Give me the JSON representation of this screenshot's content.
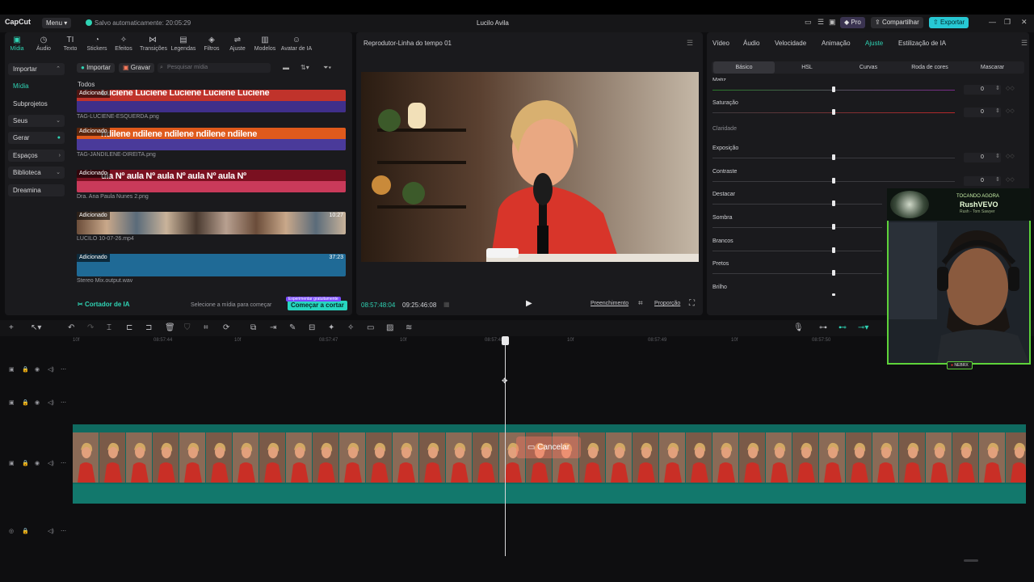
{
  "app": {
    "logo": "CapCut",
    "menu": "Menu",
    "autosave": "Salvo automaticamente: 20:05:29",
    "title": "Lucilo Avila",
    "pro": "Pro",
    "share": "Compartilhar",
    "export": "Exportar"
  },
  "toolbar": {
    "tools": [
      {
        "label": "Mídia",
        "icon": "media-icon"
      },
      {
        "label": "Áudio",
        "icon": "audio-icon"
      },
      {
        "label": "Texto",
        "icon": "text-icon"
      },
      {
        "label": "Stickers",
        "icon": "sticker-icon"
      },
      {
        "label": "Efeitos",
        "icon": "effects-icon"
      },
      {
        "label": "Transições",
        "icon": "transition-icon"
      },
      {
        "label": "Legendas",
        "icon": "captions-icon"
      },
      {
        "label": "Filtros",
        "icon": "filter-icon"
      },
      {
        "label": "Ajuste",
        "icon": "adjust-icon"
      },
      {
        "label": "Modelos",
        "icon": "templates-icon"
      },
      {
        "label": "Avatar de IA",
        "icon": "ai-avatar-icon"
      }
    ]
  },
  "sidebar": {
    "items": [
      {
        "label": "Importar"
      },
      {
        "label": "Mídia"
      },
      {
        "label": "Subprojetos"
      },
      {
        "label": "Seus"
      },
      {
        "label": "Gerar"
      },
      {
        "label": "Espaços"
      },
      {
        "label": "Biblioteca"
      },
      {
        "label": "Dreamina"
      }
    ]
  },
  "media": {
    "import_btn": "Importar",
    "record_btn": "Gravar",
    "search_placeholder": "Pesquisar mídia",
    "section": "Todos",
    "added_badge": "Adicionado",
    "items": [
      {
        "name": "TAG-LUCIENE-ESQUERDA.png",
        "text": "Luciene Luciene Luciene Luciene Luciene",
        "duration": ""
      },
      {
        "name": "TAG-JANDILENE-DIREITA.png",
        "text": "ndilene ndilene ndilene ndilene ndilene",
        "duration": ""
      },
      {
        "name": "Dra. Ana Paula Nunes 2.png",
        "text": "ula Nº aula Nº aula Nº aula Nº aula Nº",
        "duration": ""
      },
      {
        "name": "LUCILO 10-07-26.mp4",
        "text": "",
        "duration": "10:27"
      },
      {
        "name": "Stereo Mix.output.wav",
        "text": "",
        "duration": "37:23"
      }
    ],
    "ai_cutter": "Cortador de IA",
    "ai_hint": "Selecione a mídia para começar",
    "ai_start": "Começar a cortar",
    "ai_trial": "Experimentar gratuitamente"
  },
  "player": {
    "title": "Reprodutor-Linha do tempo 01",
    "current_time": "08:57:48:04",
    "total_time": "09:25:46:08",
    "fill": "Preenchimento",
    "ratio": "Proporção"
  },
  "adjust": {
    "tabs": [
      "Vídeo",
      "Áudio",
      "Velocidade",
      "Animação",
      "Ajuste",
      "Estilização de IA"
    ],
    "subtabs": [
      "Básico",
      "HSL",
      "Curvas",
      "Roda de cores",
      "Mascarar"
    ],
    "section_light": "Claridade",
    "sliders": [
      {
        "label": "Matiz",
        "value": "0"
      },
      {
        "label": "Saturação",
        "value": "0"
      },
      {
        "label": "Exposição",
        "value": "0"
      },
      {
        "label": "Contraste",
        "value": "0"
      },
      {
        "label": "Destacar",
        "value": ""
      },
      {
        "label": "Sombra",
        "value": ""
      },
      {
        "label": "Brancos",
        "value": ""
      },
      {
        "label": "Pretos",
        "value": ""
      },
      {
        "label": "Brilho",
        "value": ""
      }
    ]
  },
  "timeline": {
    "ticks": [
      "10f",
      "08:57:44",
      "10f",
      "08:57:47",
      "10f",
      "08:57:48",
      "10f",
      "08:57:49",
      "10f",
      "08:57:50"
    ],
    "cancel": "Cancelar"
  },
  "webcam": {
    "tag": "TOCANDO AGORA",
    "name": "RushVEVO",
    "sub": "Rush - Tom Sawyer",
    "badge": "NEBRX"
  },
  "colors": {
    "accent": "#2fd3b4",
    "export": "#27c8d4",
    "clip": "#0f6a60"
  }
}
